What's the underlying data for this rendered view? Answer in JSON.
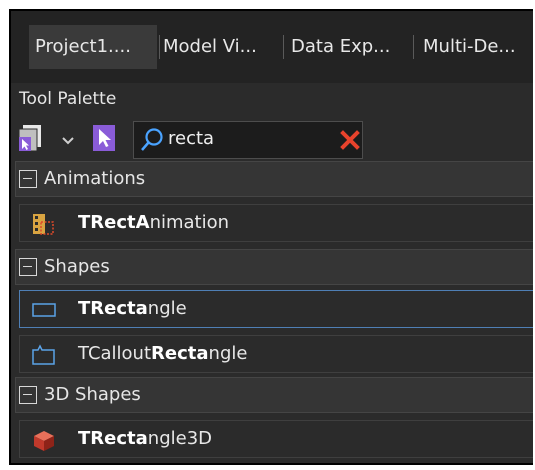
{
  "tabs": [
    {
      "label": "Project1....",
      "active": true
    },
    {
      "label": "Model Vi..."
    },
    {
      "label": "Data Exp..."
    },
    {
      "label": "Multi-De..."
    }
  ],
  "palette": {
    "title": "Tool Palette",
    "search_value": "recta",
    "icons": [
      "palette-menu-icon",
      "chevron-down-icon",
      "pointer-icon",
      "search-icon",
      "clear-icon"
    ]
  },
  "categories": [
    {
      "label": "Animations",
      "items": [
        {
          "pre": "",
          "bold1": "TRectA",
          "mid": "nimation",
          "bold2": "",
          "post": "",
          "icon": "animation-icon"
        }
      ]
    },
    {
      "label": "Shapes",
      "items": [
        {
          "pre": "",
          "bold1": "TRecta",
          "mid": "ngle",
          "bold2": "",
          "post": "",
          "icon": "rectangle-icon",
          "selected": true
        },
        {
          "pre": "TCallout",
          "bold1": "Recta",
          "mid": "ngle",
          "bold2": "",
          "post": "",
          "icon": "callout-icon"
        }
      ]
    },
    {
      "label": "3D Shapes",
      "items": [
        {
          "pre": "",
          "bold1": "TRecta",
          "mid": "ngle3D",
          "bold2": "",
          "post": "",
          "icon": "cube-3d-icon"
        }
      ]
    }
  ],
  "colors": {
    "background": "#2b2b2b",
    "selection_border": "#4f7fb5",
    "clear_icon": "#e8432c",
    "search_icon": "#4aa3ff",
    "pointer_icon": "#8a5cd8"
  }
}
